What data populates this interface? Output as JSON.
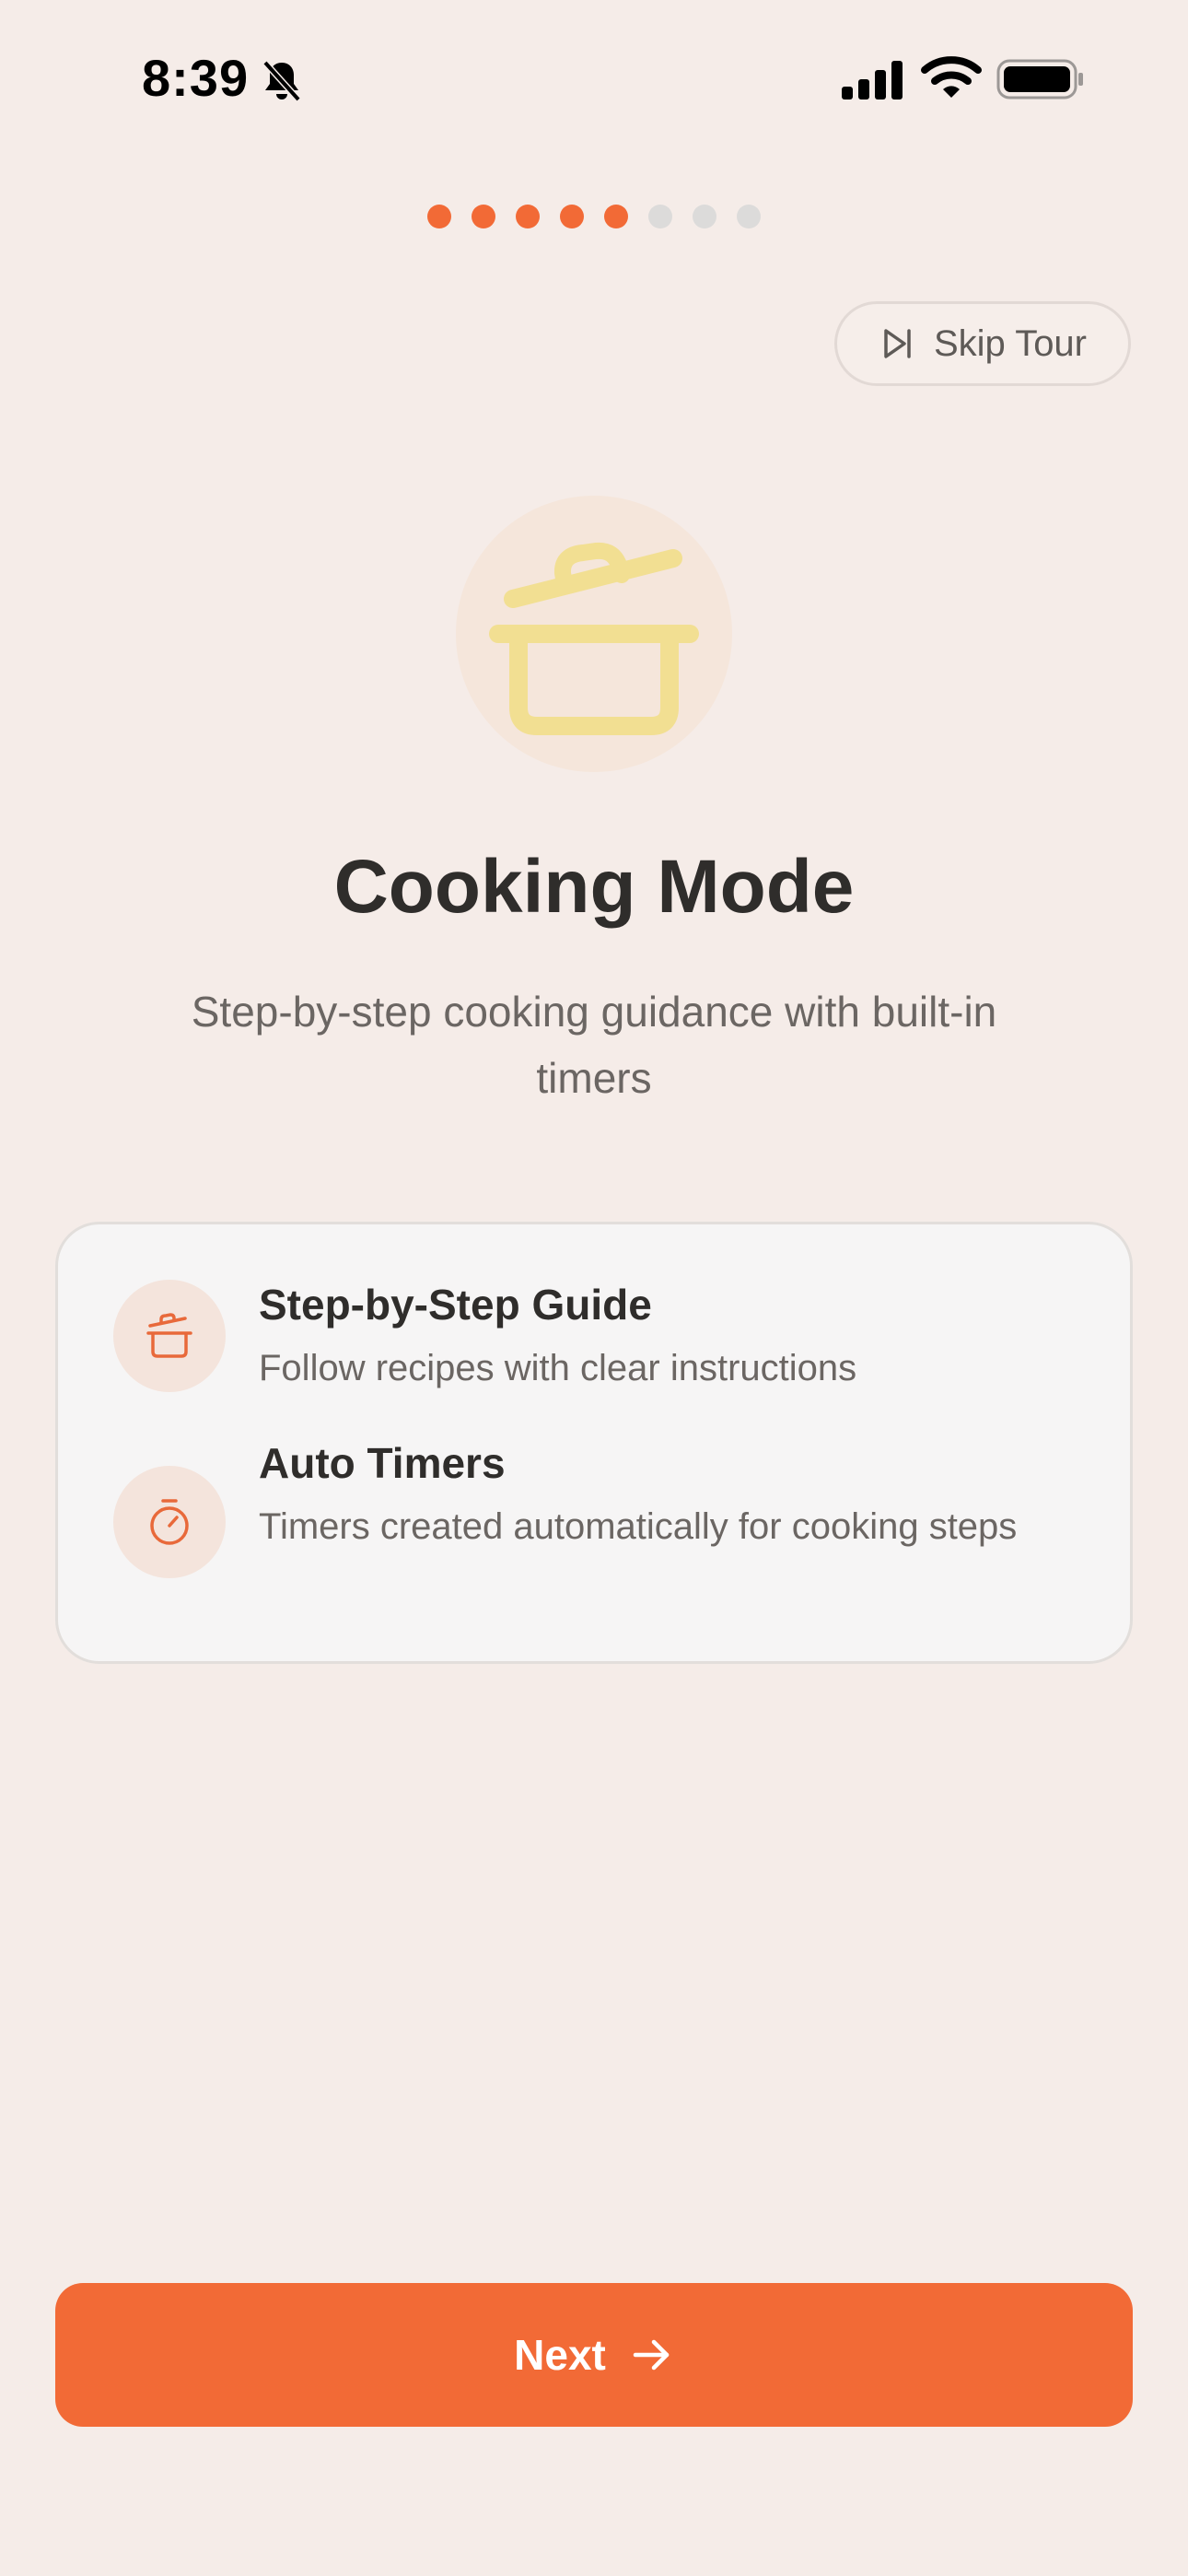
{
  "status_bar": {
    "time": "8:39",
    "icons": [
      "bell-slash-icon",
      "cellular-signal-icon",
      "wifi-icon",
      "battery-icon"
    ]
  },
  "progress": {
    "total_steps": 8,
    "current_step": 5
  },
  "skip": {
    "label": "Skip Tour",
    "icon": "skip-forward-icon"
  },
  "hero": {
    "icon": "cooking-pot-icon",
    "title": "Cooking Mode",
    "subtitle": "Step-by-step cooking guidance with built-in timers"
  },
  "features": [
    {
      "icon": "cooking-pot-icon",
      "title": "Step-by-Step Guide",
      "description": "Follow recipes with clear instructions"
    },
    {
      "icon": "timer-icon",
      "title": "Auto Timers",
      "description": "Timers created automatically for cooking steps"
    }
  ],
  "next_button": {
    "label": "Next",
    "icon": "arrow-right-icon"
  },
  "colors": {
    "accent": "#F26A36",
    "background": "#F5ECE8",
    "hero_icon": "#F2DF92",
    "inactive_dot": "#DCDBDA"
  }
}
